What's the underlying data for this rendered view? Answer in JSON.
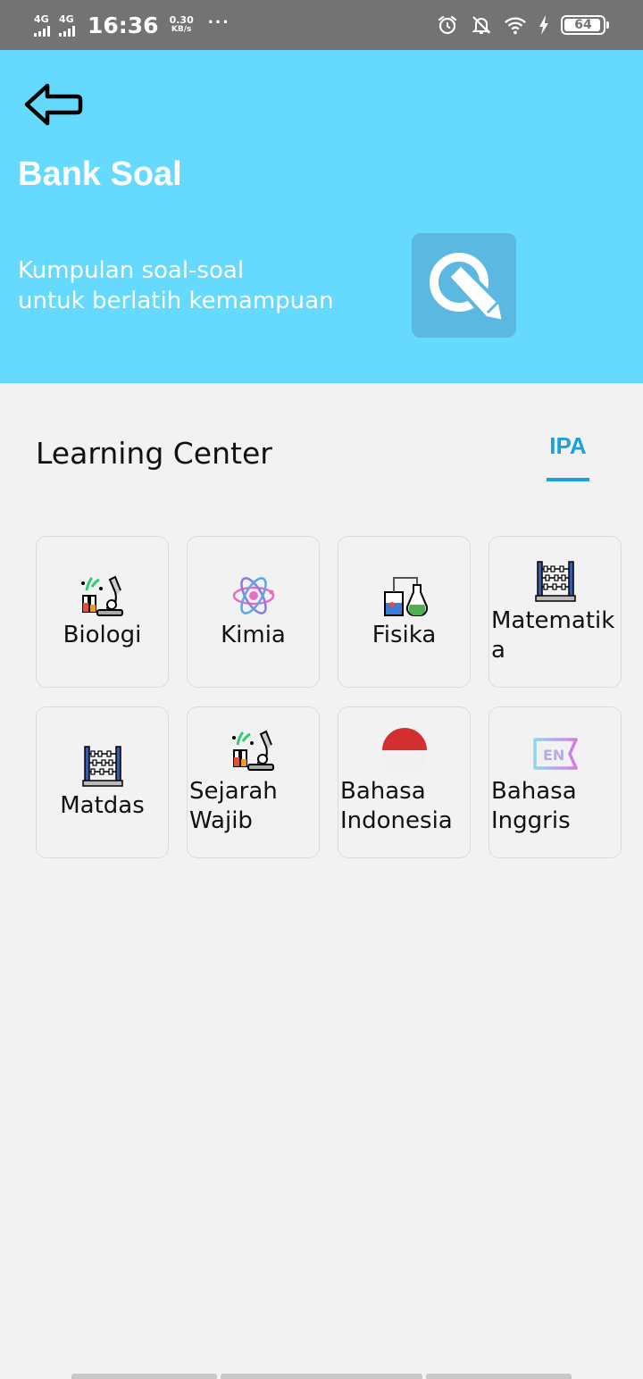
{
  "status_bar": {
    "signal1": "4G",
    "signal2": "4G",
    "time": "16:36",
    "speed_value": "0.30",
    "speed_unit": "KB/s",
    "more": "···",
    "battery": "64"
  },
  "header": {
    "title": "Bank Soal",
    "subtitle_line1": "Kumpulan soal-soal",
    "subtitle_line2": "untuk berlatih kemampuan",
    "background_color": "#66d9fe",
    "badge_icon": "search-pencil-icon"
  },
  "learning_center": {
    "title": "Learning Center",
    "tab_label": "IPA",
    "accent_color": "#1ba1db"
  },
  "subjects": [
    {
      "label": "Biologi",
      "icon": "microscope-icon"
    },
    {
      "label": "Kimia",
      "icon": "atom-icon"
    },
    {
      "label": "Fisika",
      "icon": "lab-flask-icon"
    },
    {
      "label": "Matematika",
      "icon": "abacus-icon"
    },
    {
      "label": "Matdas",
      "icon": "abacus-icon"
    },
    {
      "label": "Sejarah Wajib",
      "icon": "microscope-icon"
    },
    {
      "label": "Bahasa Indonesia",
      "icon": "indonesia-flag-icon"
    },
    {
      "label": "Bahasa Inggris",
      "icon": "en-language-icon"
    }
  ]
}
